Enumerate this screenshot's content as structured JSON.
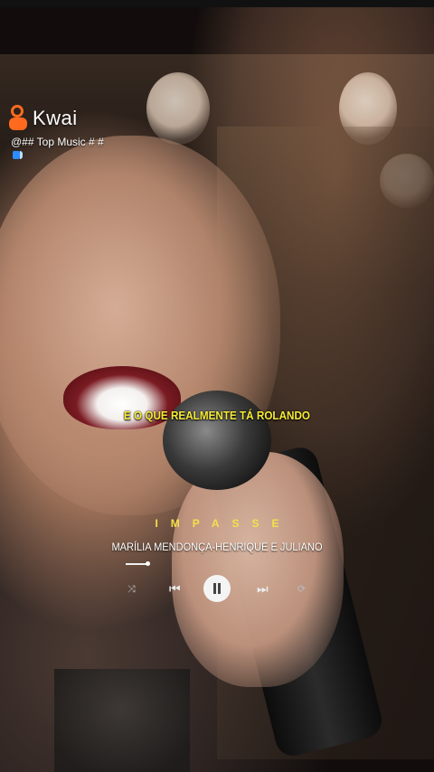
{
  "app": {
    "name": "Kwai",
    "handle": "@## Top Music # #",
    "brand_color": "#ff6a1f"
  },
  "overlay": {
    "lyric": "E O QUE REALMENTE TÁ ROLANDO",
    "song_title": "IMPASSE",
    "artist": "MARÍLIA MENDONÇA-HENRIQUE E JULIANO",
    "lyric_color": "#f7ec35"
  },
  "player": {
    "state": "playing",
    "controls": [
      "shuffle-icon",
      "previous-icon",
      "pause-icon",
      "next-icon",
      "repeat-icon"
    ]
  }
}
